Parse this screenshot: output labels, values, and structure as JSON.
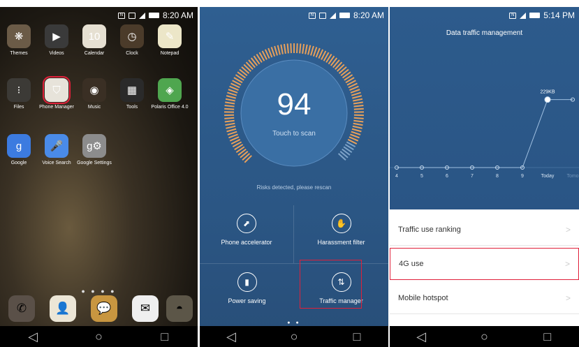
{
  "home": {
    "status": {
      "time": "8:20 AM"
    },
    "apps": [
      {
        "label": "Themes",
        "icon": "themes-icon",
        "glyph": "❋",
        "color": "#6b5b47"
      },
      {
        "label": "Videos",
        "icon": "videos-icon",
        "glyph": "▶",
        "color": "#3a3a3a"
      },
      {
        "label": "Calendar",
        "icon": "calendar-icon",
        "glyph": "10",
        "color": "#e6e0d2"
      },
      {
        "label": "Clock",
        "icon": "clock-icon",
        "glyph": "◷",
        "color": "#4b3b2a"
      },
      {
        "label": "Notepad",
        "icon": "notepad-icon",
        "glyph": "✎",
        "color": "#ece6c8"
      },
      {
        "label": "Files",
        "icon": "files-icon",
        "glyph": "⁝",
        "color": "#3c3a36"
      },
      {
        "label": "Phone Manager",
        "icon": "phone-manager-icon",
        "glyph": "⛉",
        "color": "#e7e3da"
      },
      {
        "label": "Music",
        "icon": "music-icon",
        "glyph": "◉",
        "color": "#3a2f24"
      },
      {
        "label": "Tools",
        "icon": "tools-icon",
        "glyph": "▦",
        "color": "#2a2a2a"
      },
      {
        "label": "Polaris Office 4.0",
        "icon": "polaris-office-icon",
        "glyph": "◈",
        "color": "#4fa64f"
      },
      {
        "label": "Google",
        "icon": "google-icon",
        "glyph": "g",
        "color": "#3c7be0"
      },
      {
        "label": "Voice Search",
        "icon": "voice-search-icon",
        "glyph": "🎤",
        "color": "#4a8be8"
      },
      {
        "label": "Google Settings",
        "icon": "google-settings-icon",
        "glyph": "g⚙",
        "color": "#8c8c8c"
      }
    ],
    "dock": [
      {
        "icon": "phone-icon",
        "glyph": "✆",
        "color": "#5a5048"
      },
      {
        "icon": "contacts-icon",
        "glyph": "👤",
        "color": "#ece6d6"
      },
      {
        "icon": "messages-icon",
        "glyph": "💬",
        "color": "#c89640"
      },
      {
        "icon": "email-icon",
        "glyph": "✉",
        "color": "#efefef"
      },
      {
        "icon": "browser-icon",
        "glyph": "◓",
        "color": "#5c5648"
      }
    ],
    "page_dots": "● ● ● ●"
  },
  "manager": {
    "status": {
      "time": "8:20 AM"
    },
    "score": "94",
    "touch_label": "Touch to scan",
    "risk_text": "Risks detected, please rescan",
    "tools": [
      {
        "label": "Phone accelerator",
        "icon": "accelerator-icon",
        "glyph": "⬈"
      },
      {
        "label": "Harassment filter",
        "icon": "harassment-filter-icon",
        "glyph": "✋"
      },
      {
        "label": "Power saving",
        "icon": "battery-icon",
        "glyph": "▮"
      },
      {
        "label": "Traffic manager",
        "icon": "traffic-manager-icon",
        "glyph": "⇅"
      }
    ],
    "page_dots": "● ●"
  },
  "traffic": {
    "status": {
      "time": "5:14 PM"
    },
    "title": "Data traffic management",
    "chart_data": {
      "type": "line",
      "categories": [
        "4",
        "5",
        "6",
        "7",
        "8",
        "9",
        "Today",
        "Tomo"
      ],
      "values": [
        0,
        0,
        0,
        0,
        0,
        0,
        229,
        229
      ],
      "data_labels": [
        "",
        "",
        "",
        "",
        "",
        "",
        "229KB",
        ""
      ],
      "unit": "KB"
    },
    "rows": [
      {
        "label": "Traffic use ranking",
        "chev": ">"
      },
      {
        "label": "4G use",
        "chev": ">"
      },
      {
        "label": "Mobile hotspot",
        "chev": ">"
      }
    ]
  },
  "nav": {
    "back": "◁",
    "home": "○",
    "recent": "□"
  }
}
